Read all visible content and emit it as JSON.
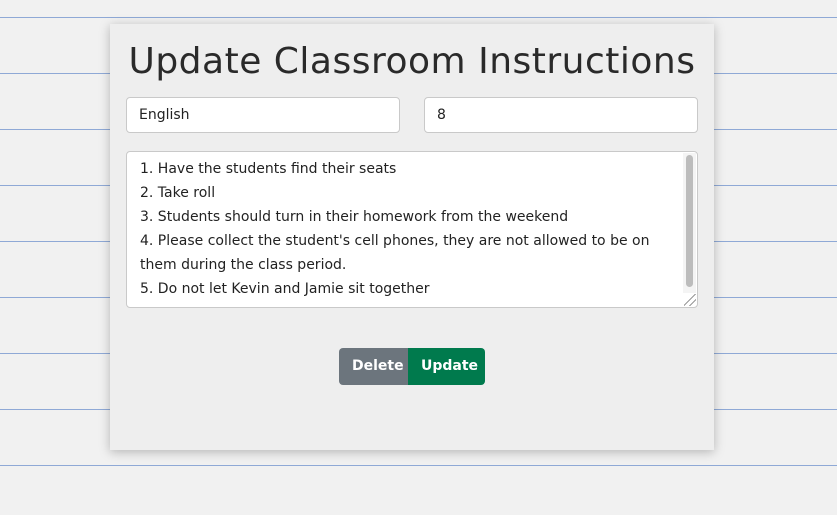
{
  "form": {
    "title": "Update Classroom Instructions",
    "subject_value": "English",
    "grade_value": "8",
    "instructions_lines": [
      "1. Have the students find their seats",
      "2. Take roll",
      "3. Students should turn in their homework from the weekend",
      "4. Please collect the student's cell phones, they are not allowed to be on",
      "them during the class period.",
      "5. Do not let Kevin and Jamie sit together"
    ],
    "delete_label": "Delete",
    "update_label": "Update"
  },
  "colors": {
    "page_background": "#f1f1f1",
    "ruled_line": "#8fa9d6",
    "card_background": "#eeeeee",
    "delete_button": "#6c757d",
    "update_button": "#007a4d"
  }
}
